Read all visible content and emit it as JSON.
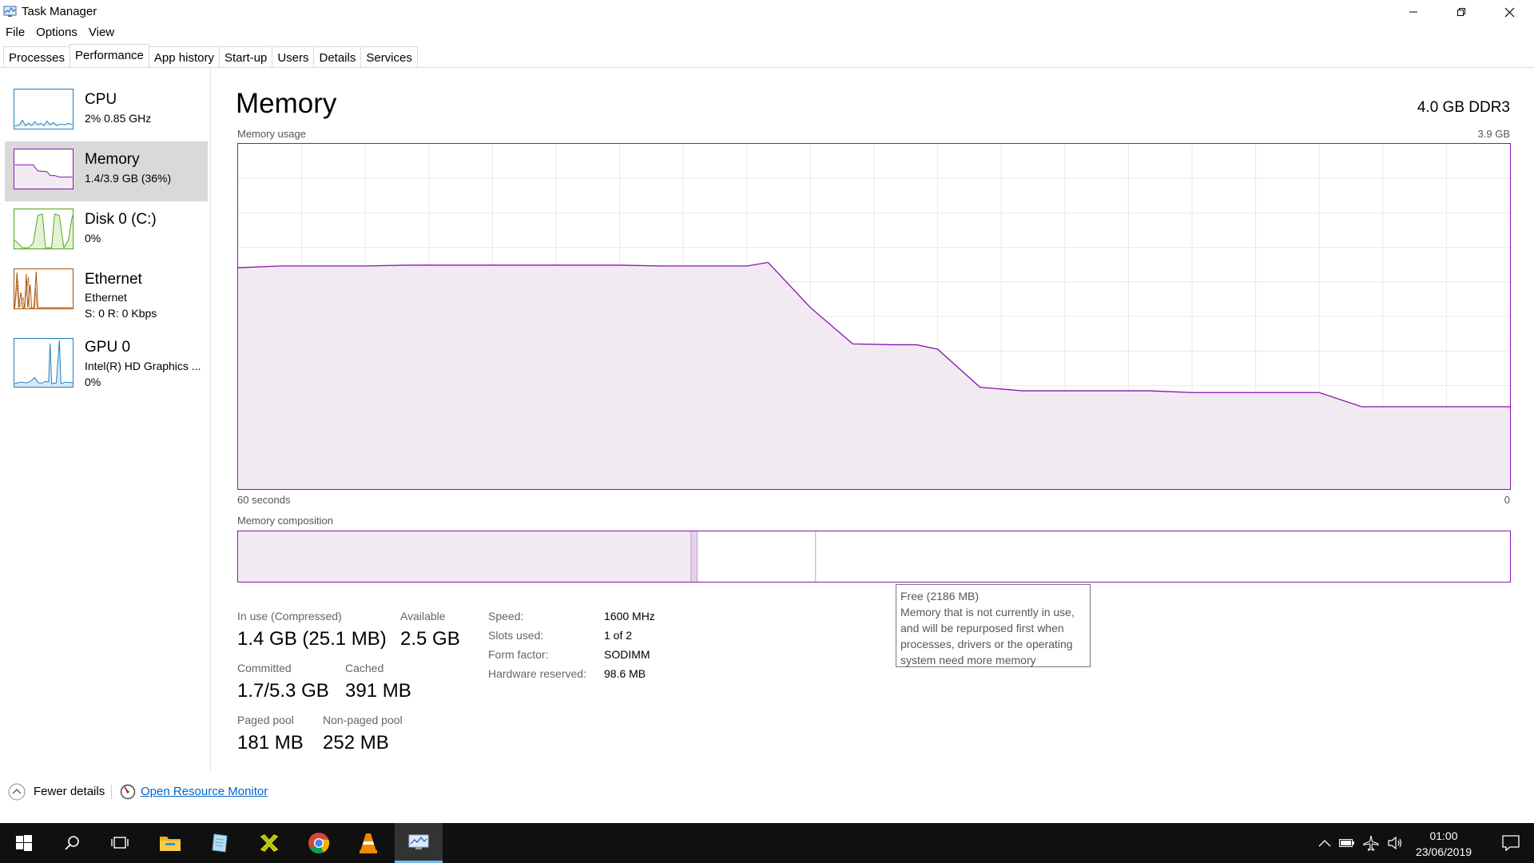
{
  "window": {
    "title": "Task Manager"
  },
  "menu": {
    "items": [
      "File",
      "Options",
      "View"
    ]
  },
  "tabs": [
    {
      "label": "Processes",
      "active": false
    },
    {
      "label": "Performance",
      "active": true
    },
    {
      "label": "App history",
      "active": false
    },
    {
      "label": "Start-up",
      "active": false
    },
    {
      "label": "Users",
      "active": false
    },
    {
      "label": "Details",
      "active": false
    },
    {
      "label": "Services",
      "active": false
    }
  ],
  "sidebar": {
    "items": [
      {
        "title": "CPU",
        "sub1": "2%  0.85 GHz",
        "sub2": "",
        "sub3": "",
        "color": "#1c7ec0"
      },
      {
        "title": "Memory",
        "sub1": "1.4/3.9 GB (36%)",
        "sub2": "",
        "sub3": "",
        "color": "#8b12ae"
      },
      {
        "title": "Disk 0 (C:)",
        "sub1": "0%",
        "sub2": "",
        "sub3": "",
        "color": "#4da60c"
      },
      {
        "title": "Ethernet",
        "sub1": "Ethernet",
        "sub2": "S: 0  R: 0 Kbps",
        "sub3": "",
        "color": "#a74f01"
      },
      {
        "title": "GPU 0",
        "sub1": "Intel(R) HD Graphics ...",
        "sub2": "0%",
        "sub3": "",
        "color": "#1c7ec0"
      }
    ]
  },
  "main": {
    "title": "Memory",
    "spec": "4.0 GB DDR3",
    "usage_label": "Memory usage",
    "usage_max": "3.9 GB",
    "axis_left": "60 seconds",
    "axis_right": "0",
    "composition_label": "Memory composition"
  },
  "tooltip": {
    "title": "Free (2186 MB)",
    "lines": [
      "Memory that is not currently in use,",
      "and will be repurposed first when",
      "processes, drivers or the operating",
      "system need more memory"
    ]
  },
  "stats": {
    "in_use_label": "In use (Compressed)",
    "in_use_value": "1.4 GB (25.1 MB)",
    "available_label": "Available",
    "available_value": "2.5 GB",
    "committed_label": "Committed",
    "committed_value": "1.7/5.3 GB",
    "cached_label": "Cached",
    "cached_value": "391 MB",
    "paged_label": "Paged pool",
    "paged_value": "181 MB",
    "nonpaged_label": "Non-paged pool",
    "nonpaged_value": "252 MB"
  },
  "specs": [
    {
      "key": "Speed:",
      "value": "1600 MHz"
    },
    {
      "key": "Slots used:",
      "value": "1 of 2"
    },
    {
      "key": "Form factor:",
      "value": "SODIMM"
    },
    {
      "key": "Hardware reserved:",
      "value": "98.6 MB"
    }
  ],
  "footer": {
    "fewer_details": "Fewer details",
    "resource_monitor": "Open Resource Monitor"
  },
  "taskbar": {
    "time": "01:00",
    "date": "23/06/2019",
    "apps": [
      "start-icon",
      "search-icon",
      "task-view-icon",
      "file-explorer-icon",
      "notepad-icon",
      "app-icon",
      "chrome-icon",
      "vlc-icon",
      "task-manager-icon"
    ]
  },
  "chart_data": {
    "type": "area",
    "title": "",
    "xlabel": "",
    "ylabel": "",
    "x": [
      60,
      58,
      56,
      54,
      52,
      50,
      48,
      46,
      44,
      42,
      40,
      38,
      36,
      35,
      33,
      31,
      29,
      28,
      27,
      25,
      23,
      21,
      19,
      17,
      15,
      13,
      12,
      11,
      9,
      7,
      5,
      3,
      0
    ],
    "series": [
      {
        "values": [
          2.5,
          2.52,
          2.52,
          2.52,
          2.53,
          2.53,
          2.53,
          2.53,
          2.53,
          2.53,
          2.52,
          2.52,
          2.52,
          2.56,
          2.05,
          1.64,
          1.63,
          1.63,
          1.58,
          1.15,
          1.11,
          1.11,
          1.11,
          1.11,
          1.09,
          1.09,
          1.09,
          1.09,
          1.09,
          0.93,
          0.93,
          0.93,
          0.93
        ]
      }
    ],
    "xlim": [
      60,
      0
    ],
    "ylim": [
      0,
      3.9
    ],
    "grid": true,
    "composition": {
      "in_use_fraction": 0.356,
      "modified_fraction": 0.005,
      "standby_fraction": 0.093,
      "free_fraction": 0.546
    }
  }
}
